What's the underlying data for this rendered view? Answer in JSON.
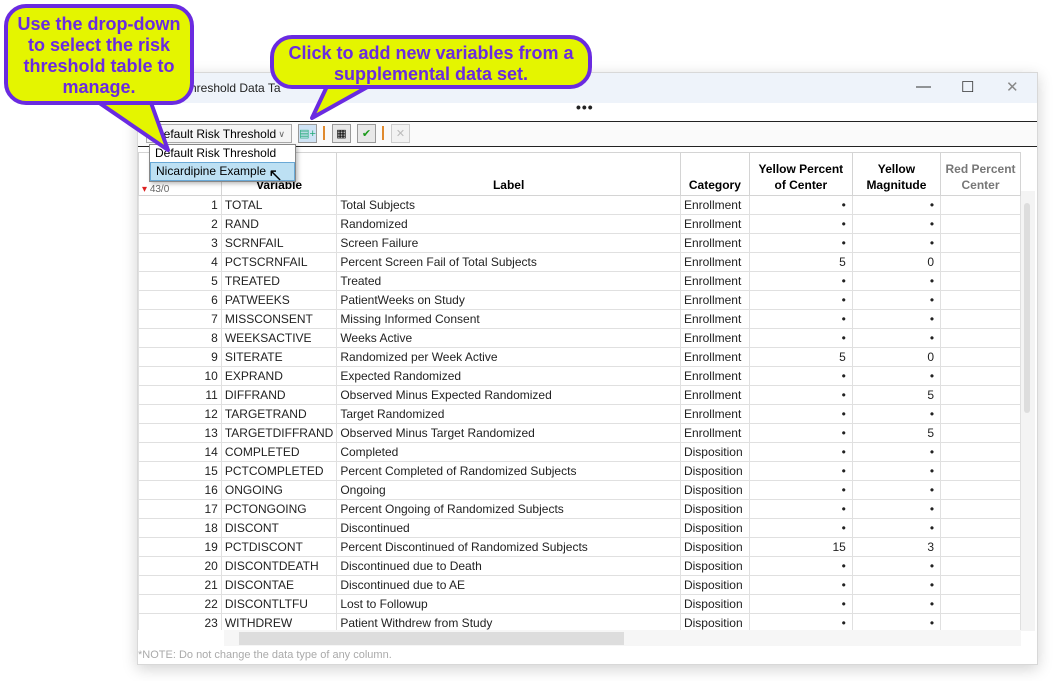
{
  "window": {
    "title": "hreshold Data Ta",
    "minimize": "—",
    "maximize": "☐",
    "close": "✕",
    "more": "•••"
  },
  "toolbar": {
    "combo_value": "Default Risk Threshold",
    "icons": [
      "add-variables-icon",
      "save-table-icon",
      "validate-table-icon",
      "delete-icon"
    ]
  },
  "dropdown": {
    "options": [
      "Default Risk Threshold",
      "Nicardipine Example"
    ],
    "selected": "Nicardipine Example"
  },
  "callouts": {
    "left": "Use the drop-down to select the risk threshold table to manage.",
    "right": "Click to add new variables from a supplemental data set."
  },
  "table": {
    "row_count_label": "43/0",
    "headers": [
      "Variable",
      "Label",
      "Category",
      "Yellow Percent of Center",
      "Yellow Magnitude",
      "Red Percent Center"
    ],
    "rows": [
      [
        "1",
        "TOTAL",
        "Total Subjects",
        "Enrollment",
        "•",
        "•"
      ],
      [
        "2",
        "RAND",
        "Randomized",
        "Enrollment",
        "•",
        "•"
      ],
      [
        "3",
        "SCRNFAIL",
        "Screen Failure",
        "Enrollment",
        "•",
        "•"
      ],
      [
        "4",
        "PCTSCRNFAIL",
        "Percent Screen Fail of Total Subjects",
        "Enrollment",
        "5",
        "0"
      ],
      [
        "5",
        "TREATED",
        "Treated",
        "Enrollment",
        "•",
        "•"
      ],
      [
        "6",
        "PATWEEKS",
        "PatientWeeks on Study",
        "Enrollment",
        "•",
        "•"
      ],
      [
        "7",
        "MISSCONSENT",
        "Missing Informed Consent",
        "Enrollment",
        "•",
        "•"
      ],
      [
        "8",
        "WEEKSACTIVE",
        "Weeks Active",
        "Enrollment",
        "•",
        "•"
      ],
      [
        "9",
        "SITERATE",
        "Randomized per Week Active",
        "Enrollment",
        "5",
        "0"
      ],
      [
        "10",
        "EXPRAND",
        "Expected Randomized",
        "Enrollment",
        "•",
        "•"
      ],
      [
        "11",
        "DIFFRAND",
        "Observed Minus Expected Randomized",
        "Enrollment",
        "•",
        "5"
      ],
      [
        "12",
        "TARGETRAND",
        "Target Randomized",
        "Enrollment",
        "•",
        "•"
      ],
      [
        "13",
        "TARGETDIFFRAND",
        "Observed Minus Target Randomized",
        "Enrollment",
        "•",
        "5"
      ],
      [
        "14",
        "COMPLETED",
        "Completed",
        "Disposition",
        "•",
        "•"
      ],
      [
        "15",
        "PCTCOMPLETED",
        "Percent Completed of Randomized Subjects",
        "Disposition",
        "•",
        "•"
      ],
      [
        "16",
        "ONGOING",
        "Ongoing",
        "Disposition",
        "•",
        "•"
      ],
      [
        "17",
        "PCTONGOING",
        "Percent Ongoing of Randomized Subjects",
        "Disposition",
        "•",
        "•"
      ],
      [
        "18",
        "DISCONT",
        "Discontinued",
        "Disposition",
        "•",
        "•"
      ],
      [
        "19",
        "PCTDISCONT",
        "Percent Discontinued of Randomized Subjects",
        "Disposition",
        "15",
        "3"
      ],
      [
        "20",
        "DISCONTDEATH",
        "Discontinued due to Death",
        "Disposition",
        "•",
        "•"
      ],
      [
        "21",
        "DISCONTAE",
        "Discontinued due to AE",
        "Disposition",
        "•",
        "•"
      ],
      [
        "22",
        "DISCONTLTFU",
        "Lost to Followup",
        "Disposition",
        "•",
        "•"
      ],
      [
        "23",
        "WITHDREW",
        "Patient Withdrew from Study",
        "Disposition",
        "•",
        "•"
      ]
    ]
  },
  "note": "*NOTE: Do not change the data type of any column."
}
